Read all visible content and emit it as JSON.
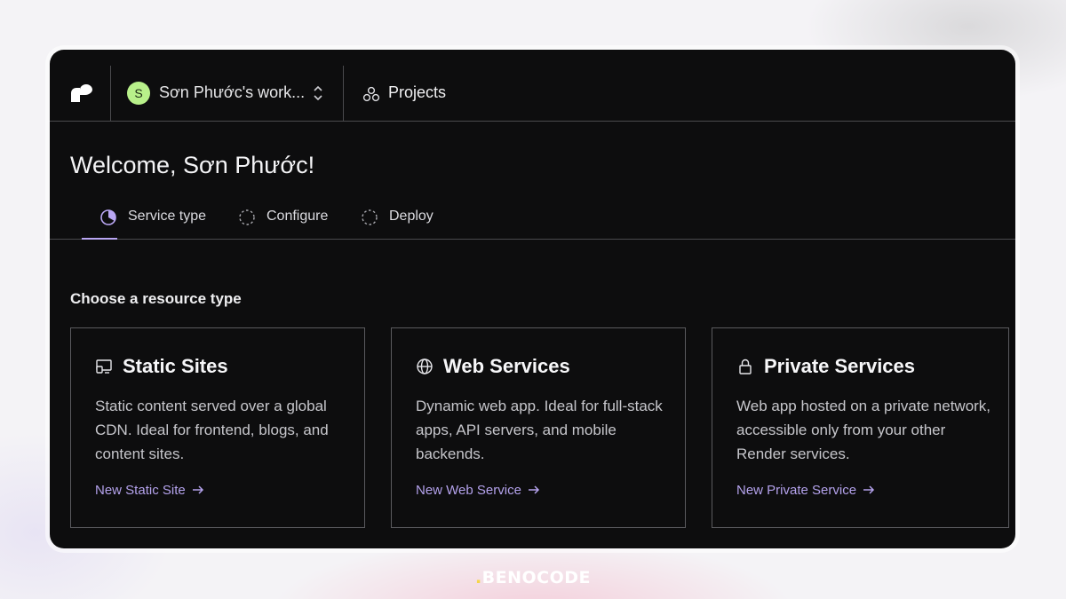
{
  "workspace": {
    "avatar_initial": "S",
    "name": "Sơn Phước's work..."
  },
  "nav": {
    "projects_label": "Projects"
  },
  "welcome": "Welcome, Sơn Phước!",
  "steps": [
    {
      "label": "Service type",
      "state": "active"
    },
    {
      "label": "Configure",
      "state": "pending"
    },
    {
      "label": "Deploy",
      "state": "pending"
    }
  ],
  "section_title": "Choose a resource type",
  "cards": [
    {
      "icon": "static-site-icon",
      "title": "Static Sites",
      "description": "Static content served over a global CDN. Ideal for frontend, blogs, and content sites.",
      "link": "New Static Site"
    },
    {
      "icon": "globe-icon",
      "title": "Web Services",
      "description": "Dynamic web app. Ideal for full-stack apps, API servers, and mobile backends.",
      "link": "New Web Service"
    },
    {
      "icon": "lock-icon",
      "title": "Private Services",
      "description": "Web app hosted on a private network, accessible only from your other Render services.",
      "link": "New Private Service"
    }
  ],
  "brand": {
    "dot": ".",
    "name": "BENOCODE"
  },
  "colors": {
    "background": "#0d0d0e",
    "accent": "#b4a2ec",
    "avatar": "#b8f08a",
    "border": "#4a4a4d"
  }
}
